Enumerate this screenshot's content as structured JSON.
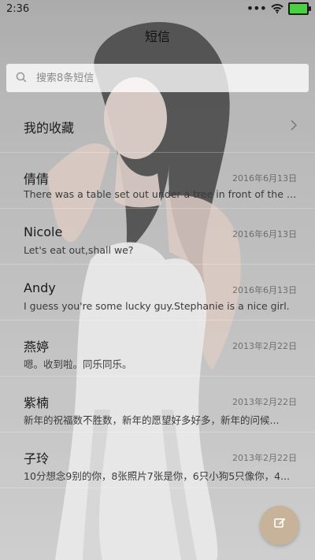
{
  "status_bar": {
    "time": "2:36",
    "dots": "•••",
    "battery_color": "#49d13f"
  },
  "header": {
    "title": "短信"
  },
  "search": {
    "placeholder": "搜索8条短信",
    "icon": "search-icon"
  },
  "favorites": {
    "label": "我的收藏",
    "icon": "chevron-right-icon"
  },
  "threads": [
    {
      "name": "倩倩",
      "date": "2016年6月13日",
      "snippet": "There was a table set out under a tree in front of the ho..."
    },
    {
      "name": "Nicole",
      "date": "2016年6月13日",
      "snippet": "Let's eat out,shall we?"
    },
    {
      "name": "Andy",
      "date": "2016年6月13日",
      "snippet": "I guess you're some lucky guy.Stephanie is a nice girl."
    },
    {
      "name": "燕婷",
      "date": "2013年2月22日",
      "snippet": "嗯。收到啦。同乐同乐。"
    },
    {
      "name": "紫楠",
      "date": "2013年2月22日",
      "snippet": "新年的祝福数不胜数，新年的愿望好多好多，新年的问候..."
    },
    {
      "name": "子玲",
      "date": "2013年2月22日",
      "snippet": "10分想念9别的你，8张照片7张是你，6只小狗5只像你，4..."
    }
  ],
  "compose": {
    "icon": "compose-icon",
    "color": "#c6b39a"
  }
}
